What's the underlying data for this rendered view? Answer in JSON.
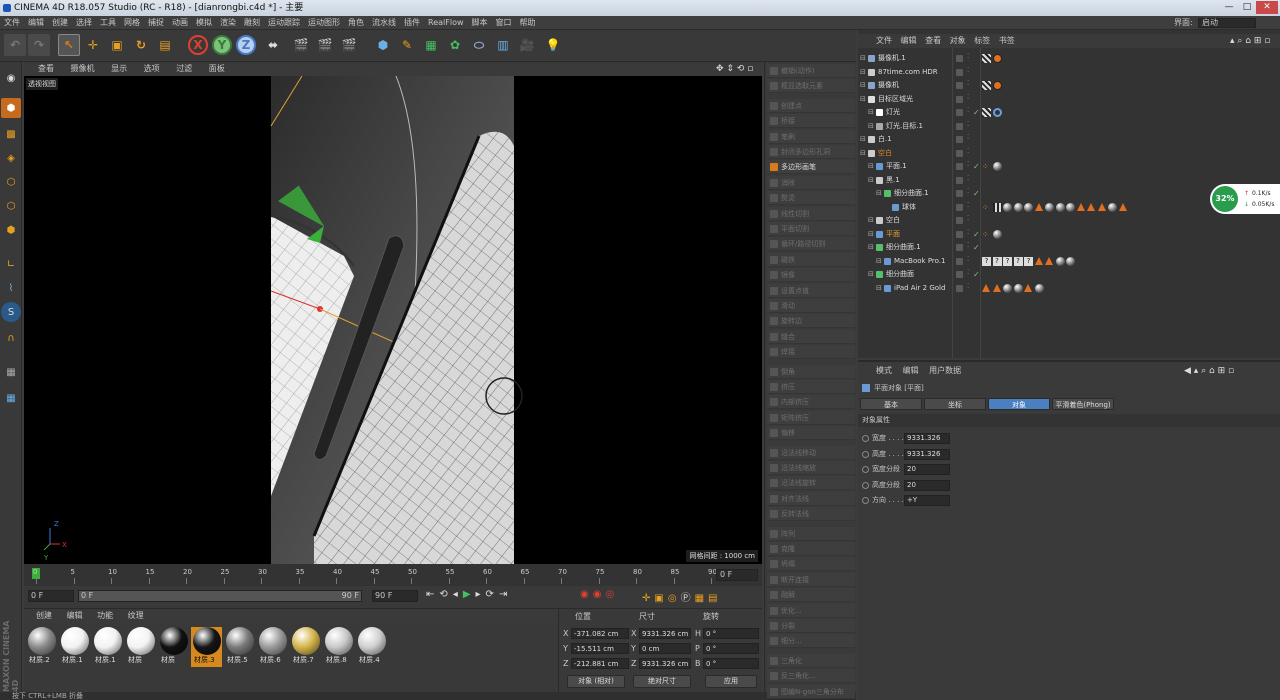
{
  "title": "CINEMA 4D R18.057 Studio (RC - R18) - [dianrongbi.c4d *] - 主要",
  "menu": [
    "文件",
    "编辑",
    "创建",
    "选择",
    "工具",
    "网格",
    "捕捉",
    "动画",
    "模拟",
    "渲染",
    "雕刻",
    "运动跟踪",
    "运动图形",
    "角色",
    "流水线",
    "插件",
    "RealFlow",
    "脚本",
    "窗口",
    "帮助"
  ],
  "layout": {
    "label": "界面:",
    "value": "启动"
  },
  "viewport": {
    "menu": [
      "查看",
      "摄像机",
      "显示",
      "选项",
      "过滤",
      "面板"
    ],
    "label": "透视视图",
    "grid": "网格间距 : 1000 cm"
  },
  "timeline": {
    "ticks": [
      "0",
      "5",
      "10",
      "15",
      "20",
      "25",
      "30",
      "35",
      "40",
      "45",
      "50",
      "55",
      "60",
      "65",
      "70",
      "75",
      "80",
      "85",
      "90"
    ],
    "frame": "0 F",
    "start": "0 F",
    "cur": "0 F",
    "end": "90 F",
    "end2": "90 F"
  },
  "materials": {
    "menu": [
      "创建",
      "编辑",
      "功能",
      "纹理"
    ],
    "items": [
      {
        "label": "材质.2",
        "color": "#8a8a8a"
      },
      {
        "label": "材质.1",
        "color": "#f2f2f2"
      },
      {
        "label": "材质.1",
        "color": "#f2f2f2"
      },
      {
        "label": "材质",
        "color": "#f2f2f2"
      },
      {
        "label": "材质",
        "color": "#111111"
      },
      {
        "label": "材质.3",
        "color": "#151515"
      },
      {
        "label": "材质.5",
        "color": "#7a7a7a"
      },
      {
        "label": "材质.6",
        "color": "#9a9a9a"
      },
      {
        "label": "材质.7",
        "color": "#d4b44a"
      },
      {
        "label": "材质.8",
        "color": "#c8c8c8"
      },
      {
        "label": "材质.4",
        "color": "#d0d0d0"
      }
    ]
  },
  "coords": {
    "headers": [
      "位置",
      "尺寸",
      "旋转"
    ],
    "pos": [
      [
        "X",
        "-371.082 cm"
      ],
      [
        "Y",
        "-15.511 cm"
      ],
      [
        "Z",
        "-212.881 cm"
      ]
    ],
    "size": [
      [
        "X",
        "9331.326 cm"
      ],
      [
        "Y",
        "0 cm"
      ],
      [
        "Z",
        "9331.326 cm"
      ]
    ],
    "rot": [
      [
        "H",
        "0 °"
      ],
      [
        "P",
        "0 °"
      ],
      [
        "B",
        "0 °"
      ]
    ],
    "mode1": "对象 (相对)",
    "mode2": "绝对尺寸",
    "apply": "应用"
  },
  "status": "按下 CTRL+LMB 折叠",
  "logo": "MAXON CINEMA 4D",
  "modifiers": [
    {
      "label": "撤销(动作)",
      "active": false
    },
    {
      "label": "框显选取元素",
      "active": false
    },
    {
      "label": "创建点",
      "active": false
    },
    {
      "label": "桥接",
      "active": false
    },
    {
      "label": "笔刷",
      "active": false
    },
    {
      "label": "封闭多边形孔洞",
      "active": false
    },
    {
      "label": "多边形画笔",
      "active": true
    },
    {
      "label": "消除",
      "active": false
    },
    {
      "label": "熨烫",
      "active": false
    },
    {
      "label": "线性切割",
      "active": false
    },
    {
      "label": "平面切割",
      "active": false
    },
    {
      "label": "循环/路径切割",
      "active": false
    },
    {
      "label": "磁铁",
      "active": false
    },
    {
      "label": "镜像",
      "active": false
    },
    {
      "label": "设置点值",
      "active": false
    },
    {
      "label": "滑动",
      "active": false
    },
    {
      "label": "旋转边",
      "active": false
    },
    {
      "label": "缝合",
      "active": false
    },
    {
      "label": "焊接",
      "active": false
    },
    {
      "label": "倒角",
      "active": false
    },
    {
      "label": "挤压",
      "active": false
    },
    {
      "label": "内部挤压",
      "active": false
    },
    {
      "label": "矩阵挤压",
      "active": false
    },
    {
      "label": "偏移",
      "active": false
    },
    {
      "label": "沿法线移动",
      "active": false
    },
    {
      "label": "沿法线缩放",
      "active": false
    },
    {
      "label": "沿法线旋转",
      "active": false
    },
    {
      "label": "对齐法线",
      "active": false
    },
    {
      "label": "反转法线",
      "active": false
    },
    {
      "label": "阵列",
      "active": false
    },
    {
      "label": "克隆",
      "active": false
    },
    {
      "label": "坍塌",
      "active": false
    },
    {
      "label": "断开连接",
      "active": false
    },
    {
      "label": "融解",
      "active": false
    },
    {
      "label": "优化...",
      "active": false
    },
    {
      "label": "分裂",
      "active": false
    },
    {
      "label": "细分...",
      "active": false
    },
    {
      "label": "三角化",
      "active": false
    },
    {
      "label": "反三角化...",
      "active": false
    },
    {
      "label": "图编N-gon三角分布",
      "active": false
    },
    {
      "label": "移除 N-gons",
      "active": false
    }
  ],
  "objmgr": {
    "menu": [
      "文件",
      "编辑",
      "查看",
      "对象",
      "标签",
      "书签"
    ],
    "rows": [
      {
        "name": "摄像机.1",
        "indent": 0,
        "color": "#ddd",
        "icon": "#8aa4c8"
      },
      {
        "name": "87time.com HDR",
        "indent": 0,
        "color": "#ddd",
        "icon": "#cccccc"
      },
      {
        "name": "摄像机",
        "indent": 0,
        "color": "#ddd",
        "icon": "#8aa4c8"
      },
      {
        "name": "目标区域光",
        "indent": 0,
        "color": "#ddd",
        "icon": "#dddddd"
      },
      {
        "name": "灯光",
        "indent": 1,
        "color": "#ddd",
        "icon": "#ffffff"
      },
      {
        "name": "灯光.目标.1",
        "indent": 1,
        "color": "#ddd",
        "icon": "#aaaaaa"
      },
      {
        "name": "白.1",
        "indent": 0,
        "color": "#ddd",
        "icon": "#cccccc"
      },
      {
        "name": "空白",
        "indent": 0,
        "color": "#e08a2a",
        "icon": "#cccccc"
      },
      {
        "name": "平面.1",
        "indent": 1,
        "color": "#ddd",
        "icon": "#6a9ad4"
      },
      {
        "name": "黑.1",
        "indent": 1,
        "color": "#ddd",
        "icon": "#cccccc"
      },
      {
        "name": "细分曲面.1",
        "indent": 2,
        "color": "#ddd",
        "icon": "#55c06a"
      },
      {
        "name": "球体",
        "indent": 3,
        "color": "#ddd",
        "icon": "#6a9ad4"
      },
      {
        "name": "空白",
        "indent": 1,
        "color": "#ddd",
        "icon": "#cccccc"
      },
      {
        "name": "平面",
        "indent": 1,
        "color": "#e0a030",
        "icon": "#6a9ad4"
      },
      {
        "name": "细分曲面.1",
        "indent": 1,
        "color": "#ddd",
        "icon": "#55c06a"
      },
      {
        "name": "MacBook Pro.1",
        "indent": 2,
        "color": "#ddd",
        "icon": "#6a9ad4"
      },
      {
        "name": "细分曲面",
        "indent": 1,
        "color": "#ddd",
        "icon": "#55c06a"
      },
      {
        "name": "iPad Air 2 Gold",
        "indent": 2,
        "color": "#ddd",
        "icon": "#6a9ad4"
      }
    ]
  },
  "net": {
    "pct": "32%",
    "up": "0.1K/s",
    "down": "0.05K/s"
  },
  "attr": {
    "menu": [
      "模式",
      "编辑",
      "用户数据"
    ],
    "object": "平面对象 [平面]",
    "tabs": [
      "基本",
      "坐标",
      "对象",
      "平滑着色(Phong)"
    ],
    "section": "对象属性",
    "fields": [
      {
        "label": "宽度 . . . .",
        "value": "9331.326"
      },
      {
        "label": "高度 . . . .",
        "value": "9331.326"
      },
      {
        "label": "宽度分段",
        "value": "20"
      },
      {
        "label": "高度分段",
        "value": "20"
      },
      {
        "label": "方向 . . . .",
        "value": "+Y"
      }
    ]
  }
}
